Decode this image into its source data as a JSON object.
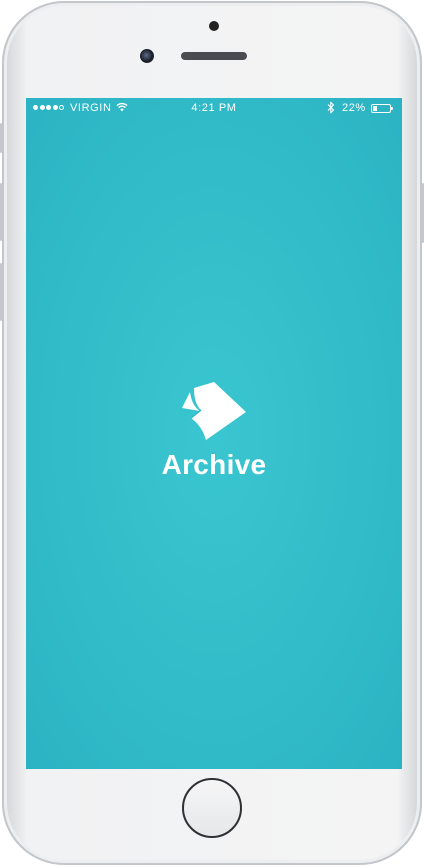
{
  "status_bar": {
    "carrier": "VIRGIN",
    "time": "4:21 PM",
    "battery_percent_label": "22%",
    "battery_level": 0.22,
    "signal_bars_filled": 4,
    "signal_bars_total": 5,
    "icons": {
      "wifi": "wifi-icon",
      "bluetooth": "bluetooth-icon",
      "battery": "battery-icon"
    }
  },
  "splash": {
    "app_name": "Archive",
    "logo_icon": "archive-paper-logo-icon",
    "background_color": "#32bccb",
    "text_color": "#ffffff"
  },
  "device": {
    "home_button_icon": "home-button"
  }
}
